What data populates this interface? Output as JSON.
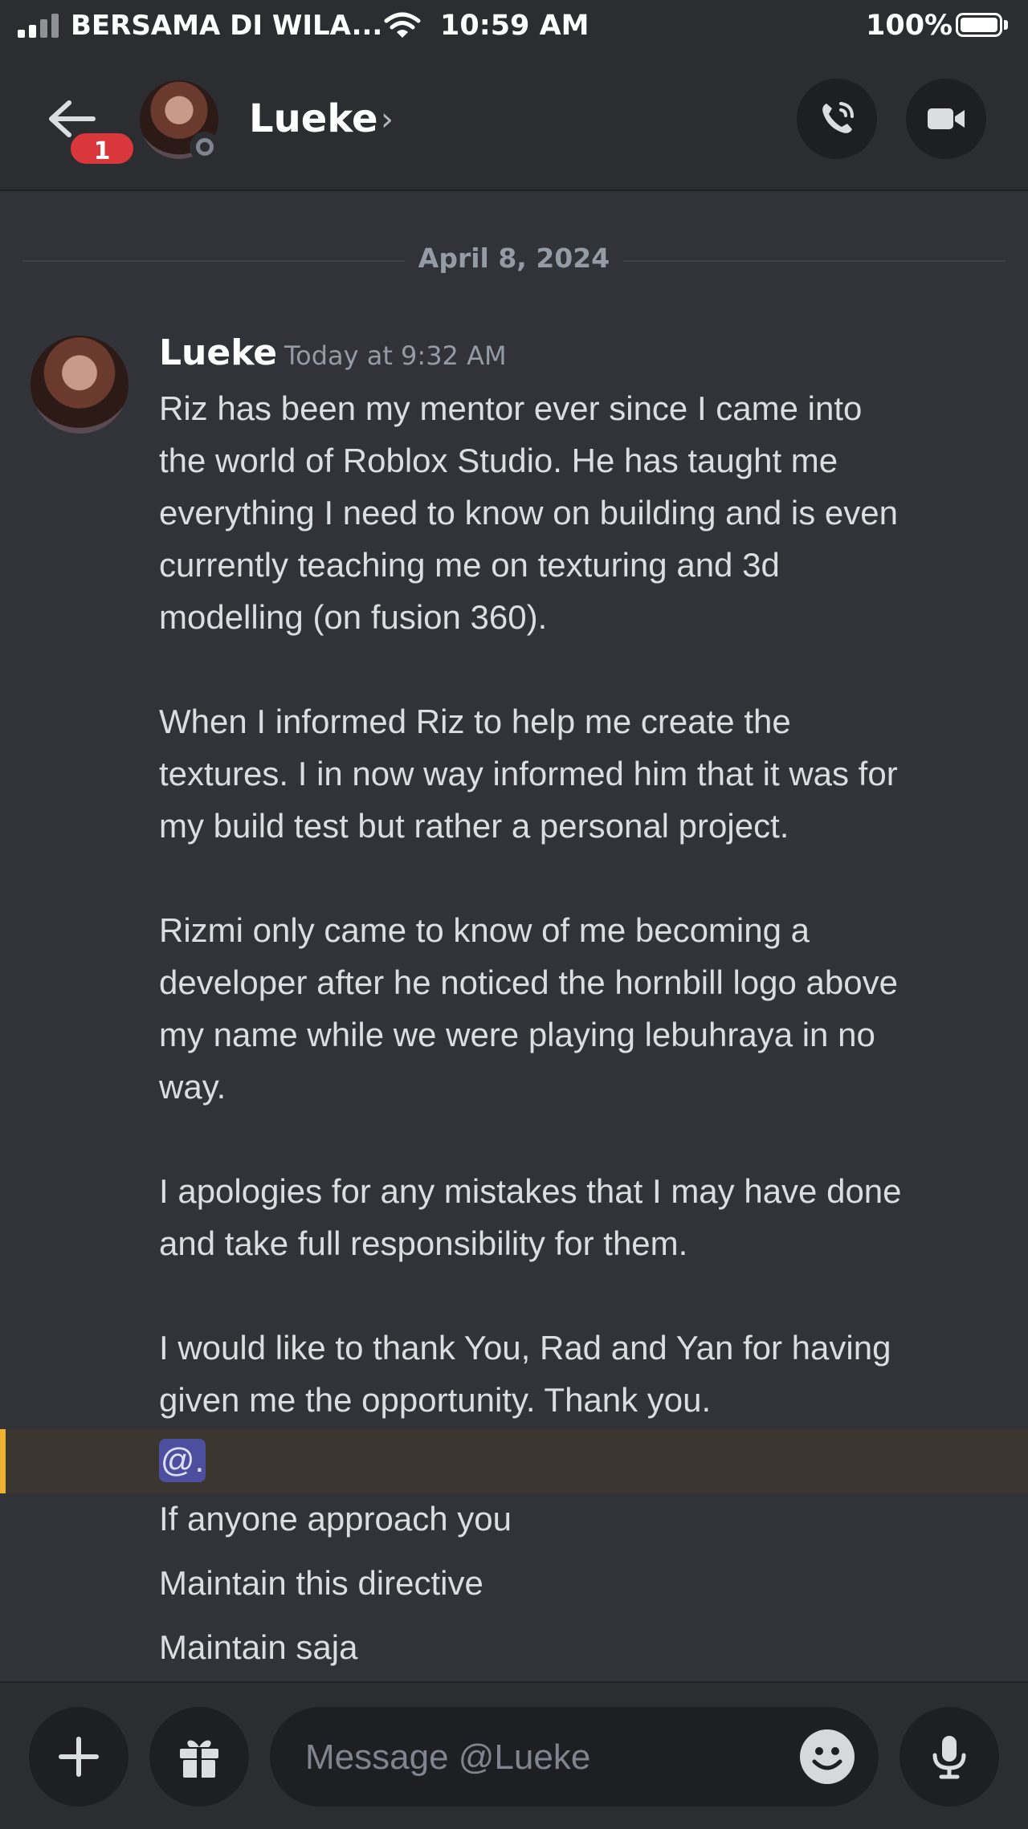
{
  "status_bar": {
    "carrier": "BERSAMA DI WILA...",
    "time": "10:59 AM",
    "battery": "100%"
  },
  "header": {
    "back_badge": "1",
    "name": "Lueke",
    "chevron": "›",
    "icons": [
      "back-arrow-icon",
      "phone-icon",
      "video-camera-icon"
    ]
  },
  "date_divider": "April 8, 2024",
  "message": {
    "author": "Lueke",
    "timestamp": "Today at 9:32 AM",
    "lines": [
      "Riz has been my mentor ever since I came into",
      "the world of Roblox Studio. He has taught me",
      "everything I need to know on building and is even",
      "currently teaching me on texturing and 3d",
      "modelling (on fusion 360).",
      "When I informed Riz to help me create the",
      "textures. I in now way informed him that it was for",
      "my build test but rather a personal project.",
      "Rizmi only came to know of me becoming a",
      "developer after he noticed the hornbill logo above",
      "my name while we were playing lebuhraya in no",
      "way.",
      "I apologies for any mistakes that I may have done",
      "and take full responsibility for them.",
      "I would like to thank You, Rad and Yan for having",
      "given me the opportunity. Thank you."
    ],
    "mention": "@.",
    "follow_ups": [
      "If anyone approach you",
      "Maintain this directive",
      "Maintain saja"
    ]
  },
  "composer": {
    "placeholder": "Message @Lueke",
    "icons": [
      "plus-icon",
      "gift-icon",
      "emoji-icon",
      "microphone-icon"
    ]
  },
  "colors": {
    "background": "#313338",
    "header": "#2b2d31",
    "mention_highlight": "#3b3630",
    "mention_bar": "#f0b232",
    "badge": "#da373c"
  }
}
